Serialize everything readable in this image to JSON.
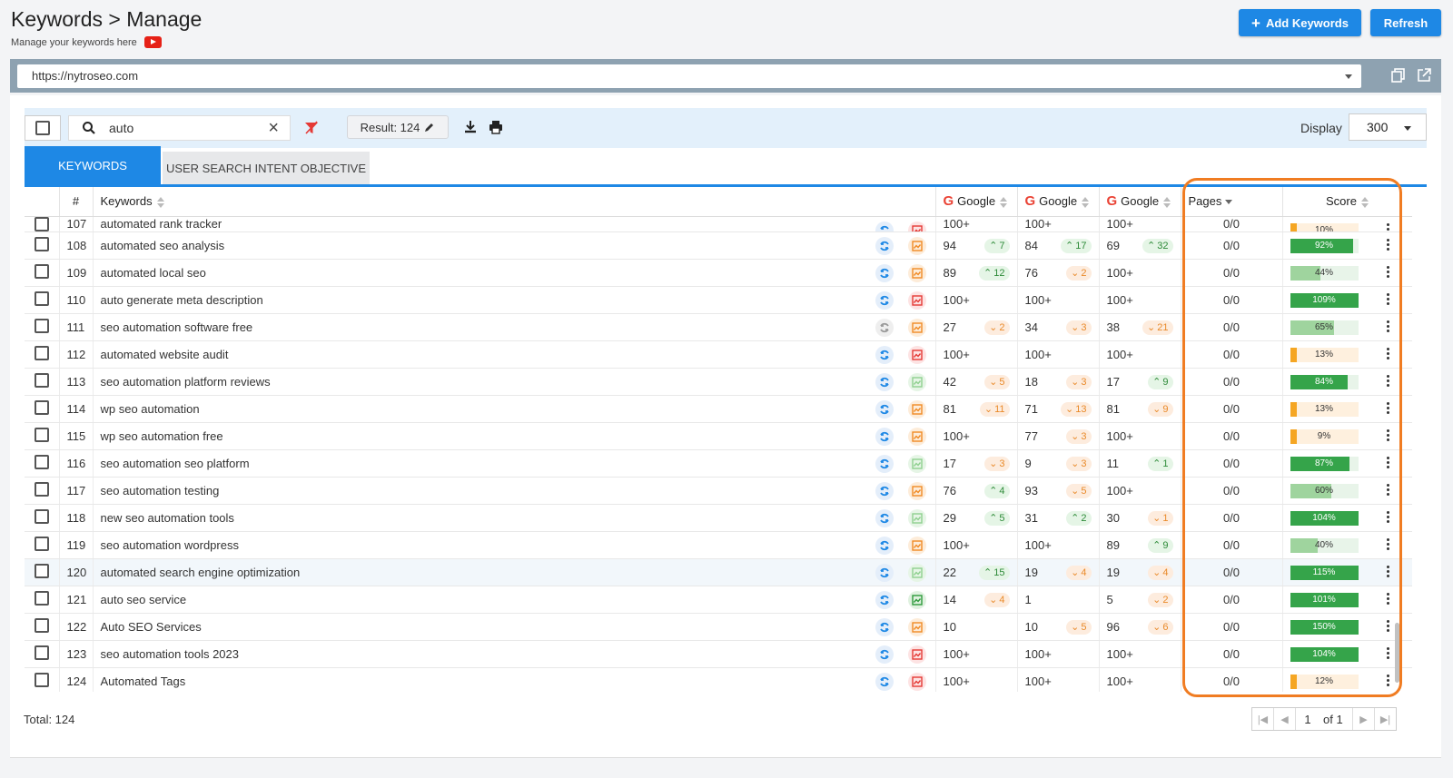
{
  "header": {
    "title": "Keywords > Manage",
    "subtitle": "Manage your keywords here",
    "add_keywords": "Add Keywords",
    "refresh": "Refresh"
  },
  "url_bar": {
    "value": "https://nytroseo.com"
  },
  "toolbar": {
    "search_value": "auto",
    "result_label": "Result: 124",
    "display_label": "Display",
    "display_value": "300"
  },
  "tabs": {
    "keywords": "KEYWORDS",
    "intent": "USER SEARCH INTENT OBJECTIVE"
  },
  "columns": {
    "num": "#",
    "keywords": "Keywords",
    "google1": "Google",
    "google2": "Google",
    "google3": "Google",
    "pages": "Pages",
    "score": "Score"
  },
  "colors": {
    "accent": "#1e88e5",
    "highlight": "#f07c22",
    "score_green": "#35a44a",
    "score_light": "#9fd49e",
    "score_orange": "#f5a623"
  },
  "rows": [
    {
      "n": "107",
      "kw": "automated rank tracker",
      "rb": "blue",
      "tr": "red",
      "g1": "100+",
      "c1": "",
      "d1": "",
      "g2": "100+",
      "c2": "",
      "d2": "",
      "g3": "100+",
      "c3": "",
      "d3": "",
      "pages": "0/0",
      "score": 10,
      "score_label": "10%"
    },
    {
      "n": "108",
      "kw": "automated seo analysis",
      "rb": "blue",
      "tr": "orange",
      "g1": "94",
      "c1": "7",
      "d1": "up",
      "g2": "84",
      "c2": "17",
      "d2": "up",
      "g3": "69",
      "c3": "32",
      "d3": "up",
      "pages": "0/0",
      "score": 92,
      "score_label": "92%"
    },
    {
      "n": "109",
      "kw": "automated local seo",
      "rb": "blue",
      "tr": "orange",
      "g1": "89",
      "c1": "12",
      "d1": "up",
      "g2": "76",
      "c2": "2",
      "d2": "down",
      "g3": "100+",
      "c3": "",
      "d3": "",
      "pages": "0/0",
      "score": 44,
      "score_label": "44%"
    },
    {
      "n": "110",
      "kw": "auto generate meta description",
      "rb": "blue",
      "tr": "red",
      "g1": "100+",
      "c1": "",
      "d1": "",
      "g2": "100+",
      "c2": "",
      "d2": "",
      "g3": "100+",
      "c3": "",
      "d3": "",
      "pages": "0/0",
      "score": 109,
      "score_label": "109%"
    },
    {
      "n": "111",
      "kw": "seo automation software free",
      "rb": "gray",
      "tr": "orange",
      "g1": "27",
      "c1": "2",
      "d1": "down",
      "g2": "34",
      "c2": "3",
      "d2": "down",
      "g3": "38",
      "c3": "21",
      "d3": "down",
      "pages": "0/0",
      "score": 65,
      "score_label": "65%"
    },
    {
      "n": "112",
      "kw": "automated website audit",
      "rb": "blue",
      "tr": "red",
      "g1": "100+",
      "c1": "",
      "d1": "",
      "g2": "100+",
      "c2": "",
      "d2": "",
      "g3": "100+",
      "c3": "",
      "d3": "",
      "pages": "0/0",
      "score": 13,
      "score_label": "13%"
    },
    {
      "n": "113",
      "kw": "seo automation platform reviews",
      "rb": "blue",
      "tr": "lightgreen",
      "g1": "42",
      "c1": "5",
      "d1": "down",
      "g2": "18",
      "c2": "3",
      "d2": "down",
      "g3": "17",
      "c3": "9",
      "d3": "up",
      "pages": "0/0",
      "score": 84,
      "score_label": "84%"
    },
    {
      "n": "114",
      "kw": "wp seo automation",
      "rb": "blue",
      "tr": "orange",
      "g1": "81",
      "c1": "11",
      "d1": "down",
      "g2": "71",
      "c2": "13",
      "d2": "down",
      "g3": "81",
      "c3": "9",
      "d3": "down",
      "pages": "0/0",
      "score": 13,
      "score_label": "13%"
    },
    {
      "n": "115",
      "kw": "wp seo automation free",
      "rb": "blue",
      "tr": "orange",
      "g1": "100+",
      "c1": "",
      "d1": "",
      "g2": "77",
      "c2": "3",
      "d2": "down",
      "g3": "100+",
      "c3": "",
      "d3": "",
      "pages": "0/0",
      "score": 9,
      "score_label": "9%"
    },
    {
      "n": "116",
      "kw": "seo automation seo platform",
      "rb": "blue",
      "tr": "lightgreen",
      "g1": "17",
      "c1": "3",
      "d1": "down",
      "g2": "9",
      "c2": "3",
      "d2": "down",
      "g3": "11",
      "c3": "1",
      "d3": "up",
      "pages": "0/0",
      "score": 87,
      "score_label": "87%"
    },
    {
      "n": "117",
      "kw": "seo automation testing",
      "rb": "blue",
      "tr": "orange",
      "g1": "76",
      "c1": "4",
      "d1": "up",
      "g2": "93",
      "c2": "5",
      "d2": "down",
      "g3": "100+",
      "c3": "",
      "d3": "",
      "pages": "0/0",
      "score": 60,
      "score_label": "60%"
    },
    {
      "n": "118",
      "kw": "new seo automation tools",
      "rb": "blue",
      "tr": "lightgreen",
      "g1": "29",
      "c1": "5",
      "d1": "up",
      "g2": "31",
      "c2": "2",
      "d2": "up",
      "g3": "30",
      "c3": "1",
      "d3": "down",
      "pages": "0/0",
      "score": 104,
      "score_label": "104%"
    },
    {
      "n": "119",
      "kw": "seo automation wordpress",
      "rb": "blue",
      "tr": "orange",
      "g1": "100+",
      "c1": "",
      "d1": "",
      "g2": "100+",
      "c2": "",
      "d2": "",
      "g3": "89",
      "c3": "9",
      "d3": "up",
      "pages": "0/0",
      "score": 40,
      "score_label": "40%"
    },
    {
      "n": "120",
      "kw": "automated search engine optimization",
      "rb": "blue",
      "tr": "lightgreen",
      "g1": "22",
      "c1": "15",
      "d1": "up",
      "g2": "19",
      "c2": "4",
      "d2": "down",
      "g3": "19",
      "c3": "4",
      "d3": "down",
      "pages": "0/0",
      "score": 115,
      "score_label": "115%",
      "highlight": true
    },
    {
      "n": "121",
      "kw": "auto seo service",
      "rb": "blue",
      "tr": "green",
      "g1": "14",
      "c1": "4",
      "d1": "down",
      "g2": "1",
      "c2": "",
      "d2": "",
      "g3": "5",
      "c3": "2",
      "d3": "down",
      "pages": "0/0",
      "score": 101,
      "score_label": "101%"
    },
    {
      "n": "122",
      "kw": "Auto SEO Services",
      "rb": "blue",
      "tr": "orange",
      "g1": "10",
      "c1": "",
      "d1": "",
      "g2": "10",
      "c2": "5",
      "d2": "down",
      "g3": "96",
      "c3": "6",
      "d3": "down",
      "pages": "0/0",
      "score": 150,
      "score_label": "150%"
    },
    {
      "n": "123",
      "kw": "seo automation tools 2023",
      "rb": "blue",
      "tr": "red",
      "g1": "100+",
      "c1": "",
      "d1": "",
      "g2": "100+",
      "c2": "",
      "d2": "",
      "g3": "100+",
      "c3": "",
      "d3": "",
      "pages": "0/0",
      "score": 104,
      "score_label": "104%"
    },
    {
      "n": "124",
      "kw": "Automated Tags",
      "rb": "blue",
      "tr": "red",
      "g1": "100+",
      "c1": "",
      "d1": "",
      "g2": "100+",
      "c2": "",
      "d2": "",
      "g3": "100+",
      "c3": "",
      "d3": "",
      "pages": "0/0",
      "score": 12,
      "score_label": "12%"
    }
  ],
  "footer": {
    "total": "Total: 124",
    "page": "1",
    "of": "of 1"
  }
}
